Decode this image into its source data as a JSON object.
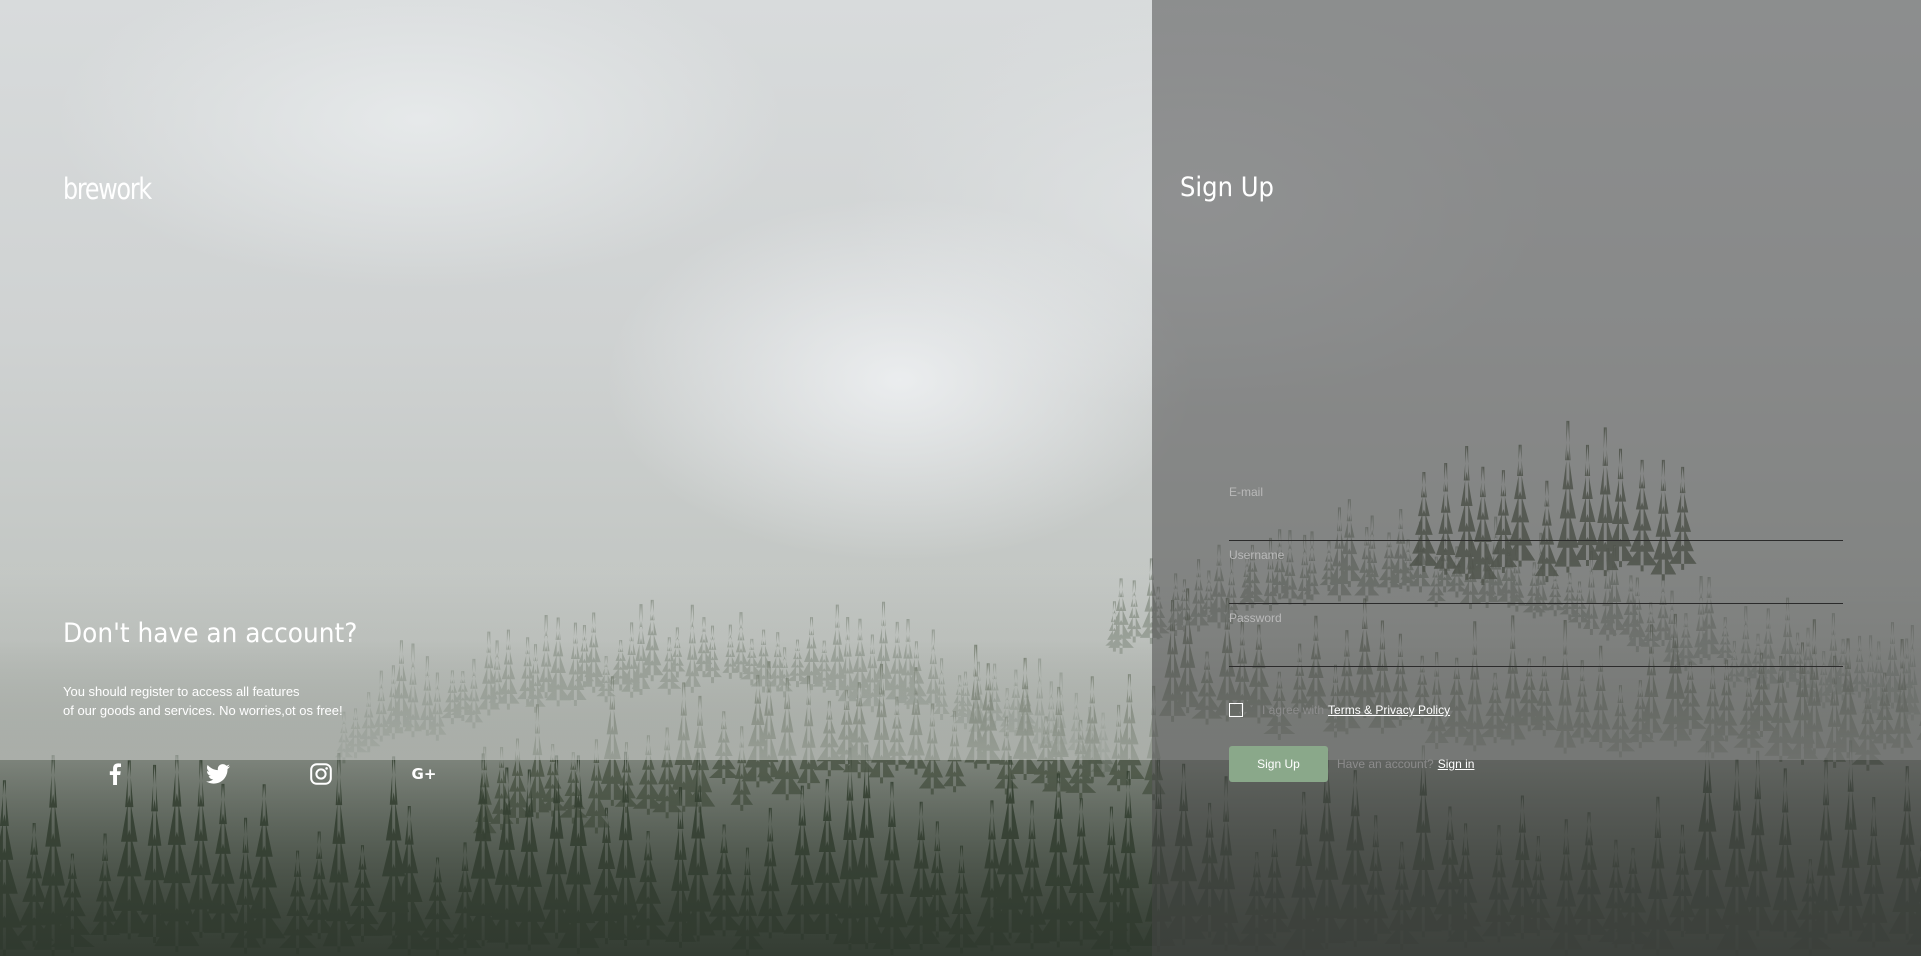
{
  "brand": {
    "logo_text": "brework"
  },
  "promo": {
    "heading": "Don't have an account?",
    "line1": "You should register to access all features",
    "line2": "of our goods and services. No worries,ot os free!"
  },
  "socials": [
    {
      "name": "facebook-icon",
      "glyph": "f"
    },
    {
      "name": "twitter-icon",
      "glyph": "bird"
    },
    {
      "name": "instagram-icon",
      "glyph": "camera"
    },
    {
      "name": "google-plus-icon",
      "glyph": "G+"
    }
  ],
  "signup": {
    "title": "Sign Up",
    "email_label": "E-mail",
    "email_value": "",
    "username_label": "Username",
    "username_value": "",
    "password_label": "Password",
    "password_value": "",
    "agree_text": "I agree with",
    "terms_link": "Terms & Privacy Policy",
    "submit_label": "Sign Up",
    "have_account_text": "Have an account?",
    "signin_link": "Sign in"
  },
  "colors": {
    "button_bg": "#8aa88a",
    "panel_overlay": "rgba(70,70,70,0.52)",
    "text": "#ffffff",
    "muted_text": "#8c8c8c"
  }
}
